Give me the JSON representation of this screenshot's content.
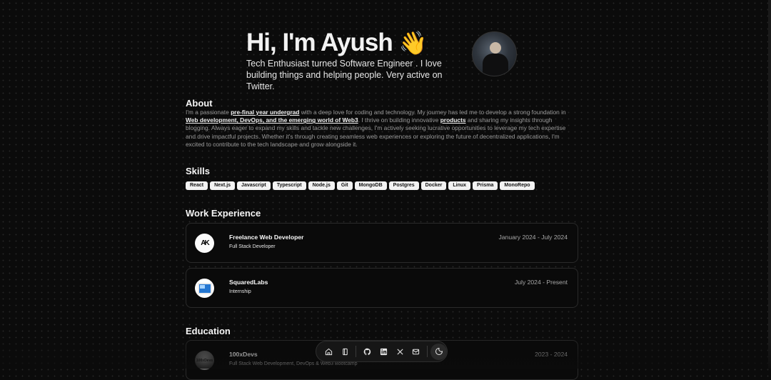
{
  "hero": {
    "greeting": "Hi, I'm Ayush",
    "wave": "👋",
    "tagline": "Tech Enthusiast turned Software Engineer . I love building things and helping people. Very active on Twitter."
  },
  "about": {
    "title": "About",
    "t1": "I'm a passionate ",
    "link1": "pre-final year undergrad",
    "t2": " with a deep love for coding and technology. My journey has led me to develop a strong foundation in ",
    "link2": "Web development, DevOps, and the emerging world of Web3",
    "t3": ". I thrive on building innovative ",
    "link3": "products",
    "t4": " and sharing my insights through blogging. Always eager to expand my skills and tackle new challenges, I'm actively seeking lucrative opportunities to leverage my tech expertise and drive impactful projects. Whether it's through creating seamless web experiences or exploring the future of decentralized applications, I'm excited to contribute to the tech landscape and grow alongside it."
  },
  "skills": {
    "title": "Skills",
    "items": [
      "React",
      "Next.js",
      "Javascript",
      "Typescript",
      "Node.js",
      "Git",
      "MongoDB",
      "Postgres",
      "Docker",
      "Linux",
      "Prisma",
      "MonoRepo"
    ]
  },
  "work": {
    "title": "Work Experience",
    "items": [
      {
        "company": "Freelance Web Developer",
        "role": "Full Stack Developer",
        "dates": "January 2024 - July 2024",
        "logo": "AK"
      },
      {
        "company": "SquaredLabs",
        "role": "Internship",
        "dates": "July 2024 - Present",
        "logo": ""
      }
    ]
  },
  "education": {
    "title": "Education",
    "items": [
      {
        "school": "100xDevs",
        "program": "Full Stack Web Development, DevOps & Web3 Bootcamp",
        "dates": "2023 - 2024",
        "logo": "100xDevs"
      }
    ]
  },
  "dock": {
    "icons": [
      "home-icon",
      "notebook-icon",
      "github-icon",
      "linkedin-icon",
      "x-icon",
      "mail-icon",
      "theme-toggle-icon"
    ]
  }
}
